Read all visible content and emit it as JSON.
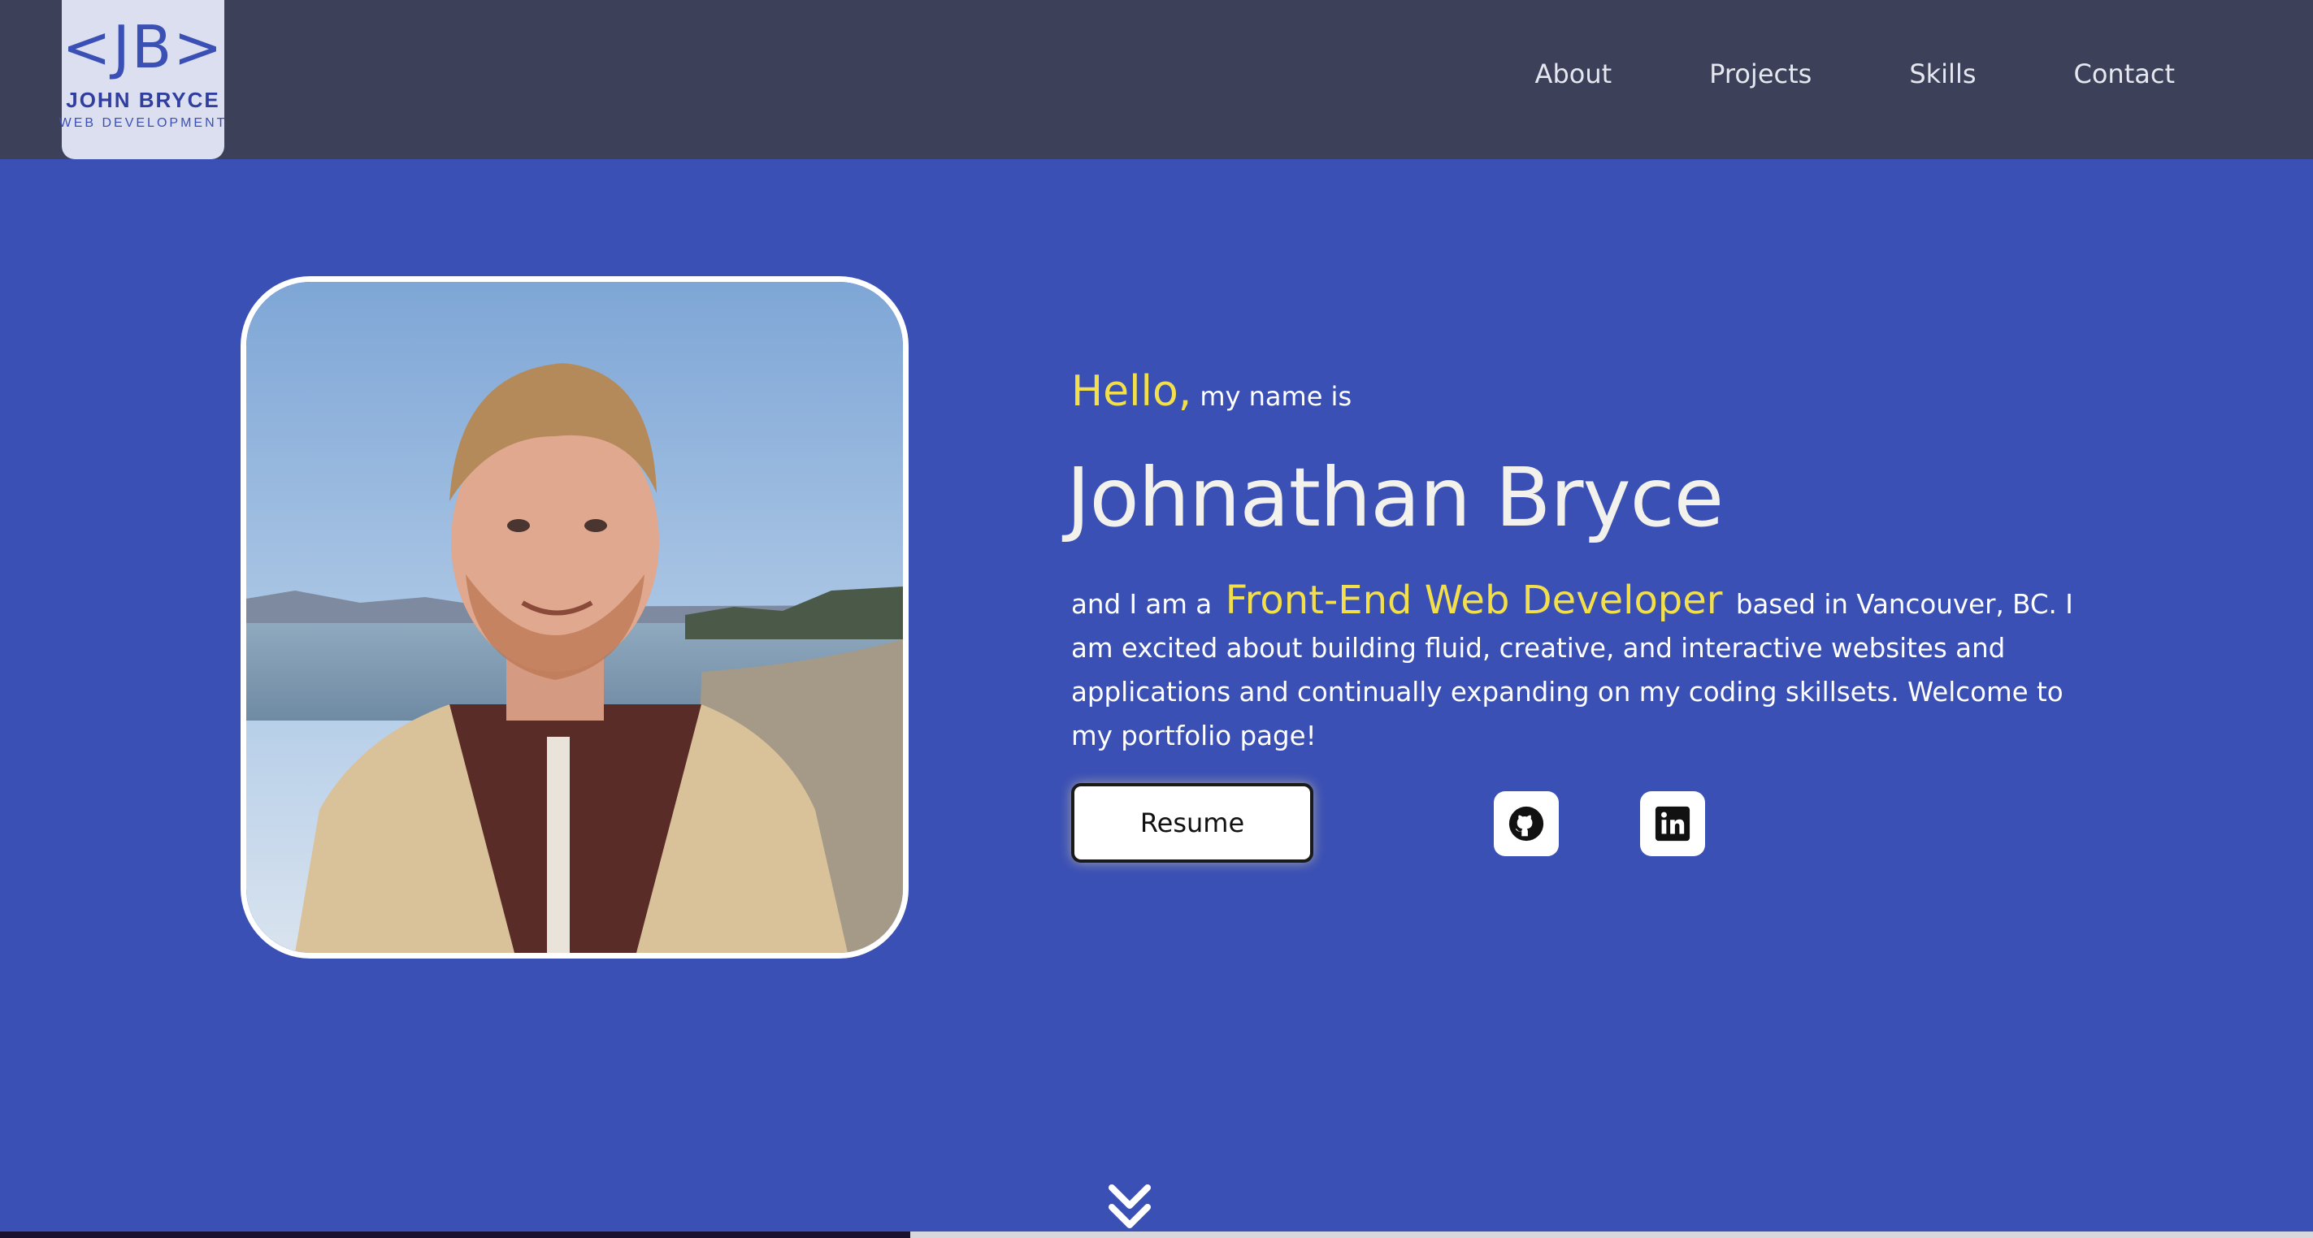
{
  "header": {
    "logo": {
      "mark": "<JB>",
      "name": "JOHN  BRYCE",
      "subtitle": "WEB DEVELOPMENT"
    },
    "nav": [
      {
        "label": "About"
      },
      {
        "label": "Projects"
      },
      {
        "label": "Skills"
      },
      {
        "label": "Contact"
      }
    ]
  },
  "hero": {
    "greeting": "Hello,",
    "greeting_suffix": "my name is",
    "name": "Johnathan Bryce",
    "bio_prefix": "and I am a",
    "role": "Front-End Web Developer",
    "bio_suffix": "based in Vancouver, BC. I am excited about building fluid, creative, and interactive websites and applications and continually expanding on my coding skillsets. Welcome to my portfolio page!",
    "resume_label": "Resume",
    "icons": [
      "github-icon",
      "linkedin-icon",
      "double-chevron-down-icon"
    ]
  },
  "colors": {
    "header_bg": "#3c4059",
    "page_bg": "#3b50b5",
    "accent_yellow": "#f2df4a",
    "logo_bg": "#dcdff0"
  }
}
